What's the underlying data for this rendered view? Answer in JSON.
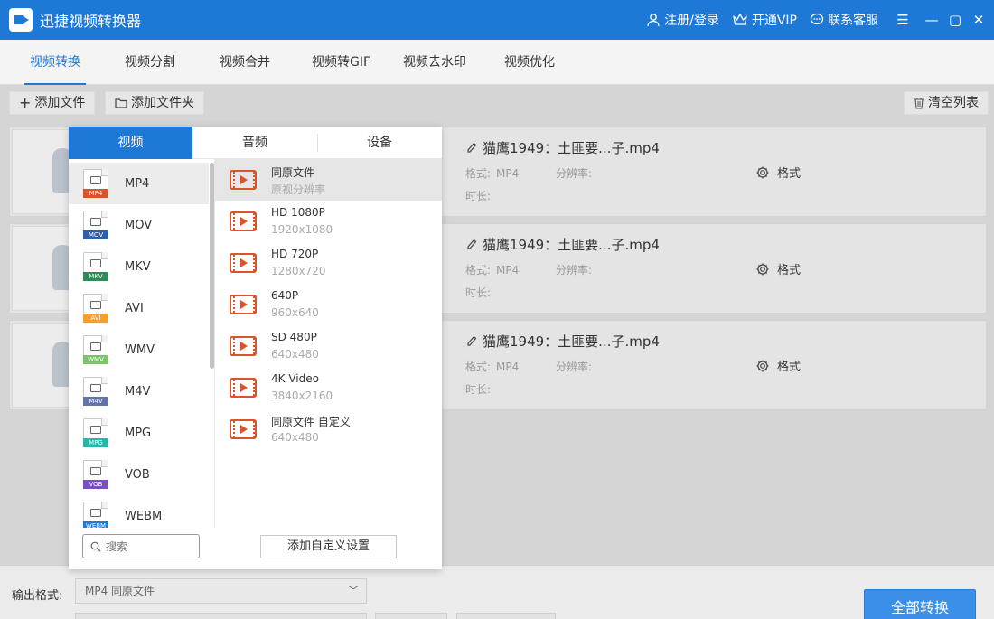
{
  "app": {
    "title": "迅捷视频转换器"
  },
  "titlebar": {
    "login": "注册/登录",
    "vip": "开通VIP",
    "service": "联系客服",
    "menu": "☰",
    "minimize": "—",
    "maximize": "▢",
    "close": "✕"
  },
  "tabs": [
    {
      "label": "视频转换",
      "active": true
    },
    {
      "label": "视频分割"
    },
    {
      "label": "视频合并"
    },
    {
      "label": "视频转GIF"
    },
    {
      "label": "视频去水印"
    },
    {
      "label": "视频优化"
    }
  ],
  "toolbar": {
    "add_file": "添加文件",
    "add_folder": "添加文件夹",
    "clear_list": "清空列表"
  },
  "files": [
    {
      "name": "猫鹰1949：土匪要...子.mp4",
      "format_label": "格式:",
      "format": "MP4",
      "resolution_label": "分辨率:",
      "resolution": "",
      "duration_label": "时长:",
      "duration": "",
      "format_button": "格式"
    },
    {
      "name": "猫鹰1949：土匪要...子.mp4",
      "format_label": "格式:",
      "format": "MP4",
      "resolution_label": "分辨率:",
      "resolution": "",
      "duration_label": "时长:",
      "duration": "",
      "format_button": "格式"
    },
    {
      "name": "猫鹰1949：土匪要...子.mp4",
      "format_label": "格式:",
      "format": "MP4",
      "resolution_label": "分辨率:",
      "resolution": "",
      "duration_label": "时长:",
      "duration": "",
      "format_button": "格式"
    }
  ],
  "panel": {
    "tabs": [
      {
        "label": "视频",
        "active": true
      },
      {
        "label": "音频"
      },
      {
        "label": "设备"
      }
    ],
    "formats": [
      {
        "name": "MP4",
        "color": "#d9542b",
        "selected": true
      },
      {
        "name": "MOV",
        "color": "#2f5fa8"
      },
      {
        "name": "MKV",
        "color": "#2e8b57"
      },
      {
        "name": "AVI",
        "color": "#f0a030"
      },
      {
        "name": "WMV",
        "color": "#7cc36a"
      },
      {
        "name": "M4V",
        "color": "#6274a8"
      },
      {
        "name": "MPG",
        "color": "#2bb5a8"
      },
      {
        "name": "VOB",
        "color": "#7b4fc0"
      },
      {
        "name": "WEBM",
        "color": "#1e78d6"
      }
    ],
    "presets": [
      {
        "name": "同原文件",
        "sub": "原视分辨率",
        "selected": true
      },
      {
        "name": "HD 1080P",
        "sub": "1920x1080"
      },
      {
        "name": "HD 720P",
        "sub": "1280x720"
      },
      {
        "name": "640P",
        "sub": "960x640"
      },
      {
        "name": "SD 480P",
        "sub": "640x480"
      },
      {
        "name": "4K Video",
        "sub": "3840x2160"
      },
      {
        "name": "同原文件 自定义",
        "sub": "640x480"
      }
    ],
    "search_placeholder": "搜索",
    "custom_button": "添加自定义设置"
  },
  "bottom": {
    "output_label": "输出格式:",
    "output_value": "MP4  同原文件",
    "convert_all": "全部转换"
  },
  "colors": {
    "accent": "#1e78d6",
    "video_icon": "#d9542b"
  }
}
